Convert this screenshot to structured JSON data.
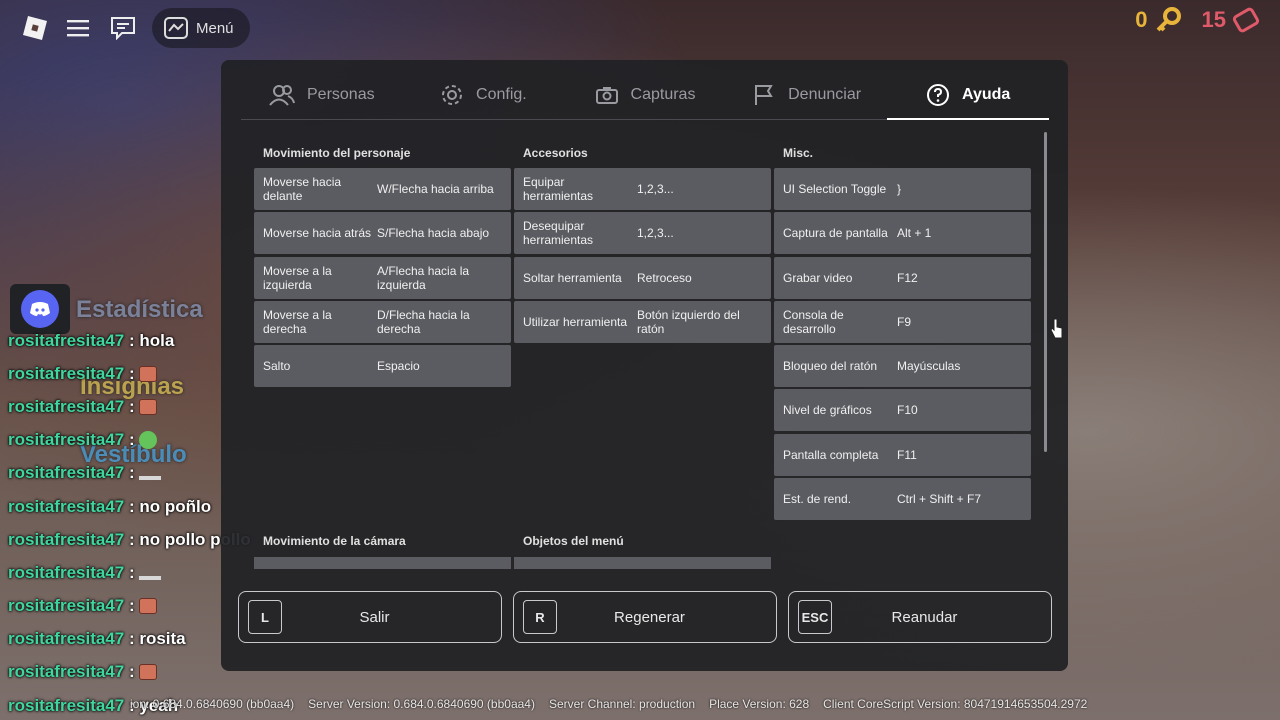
{
  "topbar": {
    "menu_label": "Menú"
  },
  "hud": {
    "coins": "0",
    "gems": "15"
  },
  "tabs": [
    {
      "label": "Personas",
      "icon": "people-icon",
      "active": false
    },
    {
      "label": "Config.",
      "icon": "gear-icon",
      "active": false
    },
    {
      "label": "Capturas",
      "icon": "camera-icon",
      "active": false
    },
    {
      "label": "Denunciar",
      "icon": "flag-icon",
      "active": false
    },
    {
      "label": "Ayuda",
      "icon": "help-icon",
      "active": true
    }
  ],
  "sections": {
    "character": {
      "title": "Movimiento del personaje",
      "rows": [
        {
          "key": "Moverse hacia delante",
          "value": "W/Flecha hacia arriba"
        },
        {
          "key": "Moverse hacia atrás",
          "value": "S/Flecha hacia abajo"
        },
        {
          "key": "Moverse a la izquierda",
          "value": "A/Flecha hacia la izquierda"
        },
        {
          "key": "Moverse a la derecha",
          "value": "D/Flecha hacia la derecha"
        },
        {
          "key": "Salto",
          "value": "Espacio"
        }
      ]
    },
    "accessories": {
      "title": "Accesorios",
      "rows": [
        {
          "key": "Equipar herramientas",
          "value": "1,2,3..."
        },
        {
          "key": "Desequipar herramientas",
          "value": "1,2,3..."
        },
        {
          "key": "Soltar herramienta",
          "value": "Retroceso"
        },
        {
          "key": "Utilizar herramienta",
          "value": "Botón izquierdo del ratón"
        }
      ]
    },
    "misc": {
      "title": "Misc.",
      "rows": [
        {
          "key": "UI Selection Toggle",
          "value": "}"
        },
        {
          "key": "Captura de pantalla",
          "value": "Alt + 1"
        },
        {
          "key": "Grabar video",
          "value": "F12"
        },
        {
          "key": "Consola de desarrollo",
          "value": "F9"
        },
        {
          "key": "Bloqueo del ratón",
          "value": "Mayúsculas"
        },
        {
          "key": "Nivel de gráficos",
          "value": "F10"
        },
        {
          "key": "Pantalla completa",
          "value": "F11"
        },
        {
          "key": "Est. de rend.",
          "value": "Ctrl + Shift + F7"
        }
      ]
    },
    "camera": {
      "title": "Movimiento de la cámara"
    },
    "menu_objects": {
      "title": "Objetos del menú"
    }
  },
  "actions": [
    {
      "key": "L",
      "label": "Salir"
    },
    {
      "key": "R",
      "label": "Regenerar"
    },
    {
      "key": "ESC",
      "label": "Reanudar"
    }
  ],
  "chat": [
    {
      "name": "rositafresita47",
      "msg": "hola",
      "emoji": ""
    },
    {
      "name": "rositafresita47",
      "msg": "",
      "emoji": "face"
    },
    {
      "name": "rositafresita47",
      "msg": "",
      "emoji": "face"
    },
    {
      "name": "rositafresita47",
      "msg": "",
      "emoji": "green"
    },
    {
      "name": "rositafresita47",
      "msg": "",
      "emoji": "dash"
    },
    {
      "name": "rositafresita47",
      "msg": "no poñlo",
      "emoji": ""
    },
    {
      "name": "rositafresita47",
      "msg": "no pollo pollo",
      "emoji": ""
    },
    {
      "name": "rositafresita47",
      "msg": "",
      "emoji": "dash"
    },
    {
      "name": "rositafresita47",
      "msg": "",
      "emoji": "face"
    },
    {
      "name": "rositafresita47",
      "msg": "rosita",
      "emoji": ""
    },
    {
      "name": "rositafresita47",
      "msg": "",
      "emoji": "face"
    },
    {
      "name": "rositafresita47",
      "msg": "yeah",
      "emoji": ""
    }
  ],
  "chat_separator": " : ",
  "side_labels": {
    "stats": "Estadística",
    "badges": "Insignias",
    "lobby": "Vestíbulo"
  },
  "versions": [
    "ion: 0.684.0.6840690 (bb0aa4)",
    "Server Version: 0.684.0.6840690 (bb0aa4)",
    "Server Channel: production",
    "Place Version: 628",
    "Client CoreScript Version: 80471914653504.2972"
  ]
}
